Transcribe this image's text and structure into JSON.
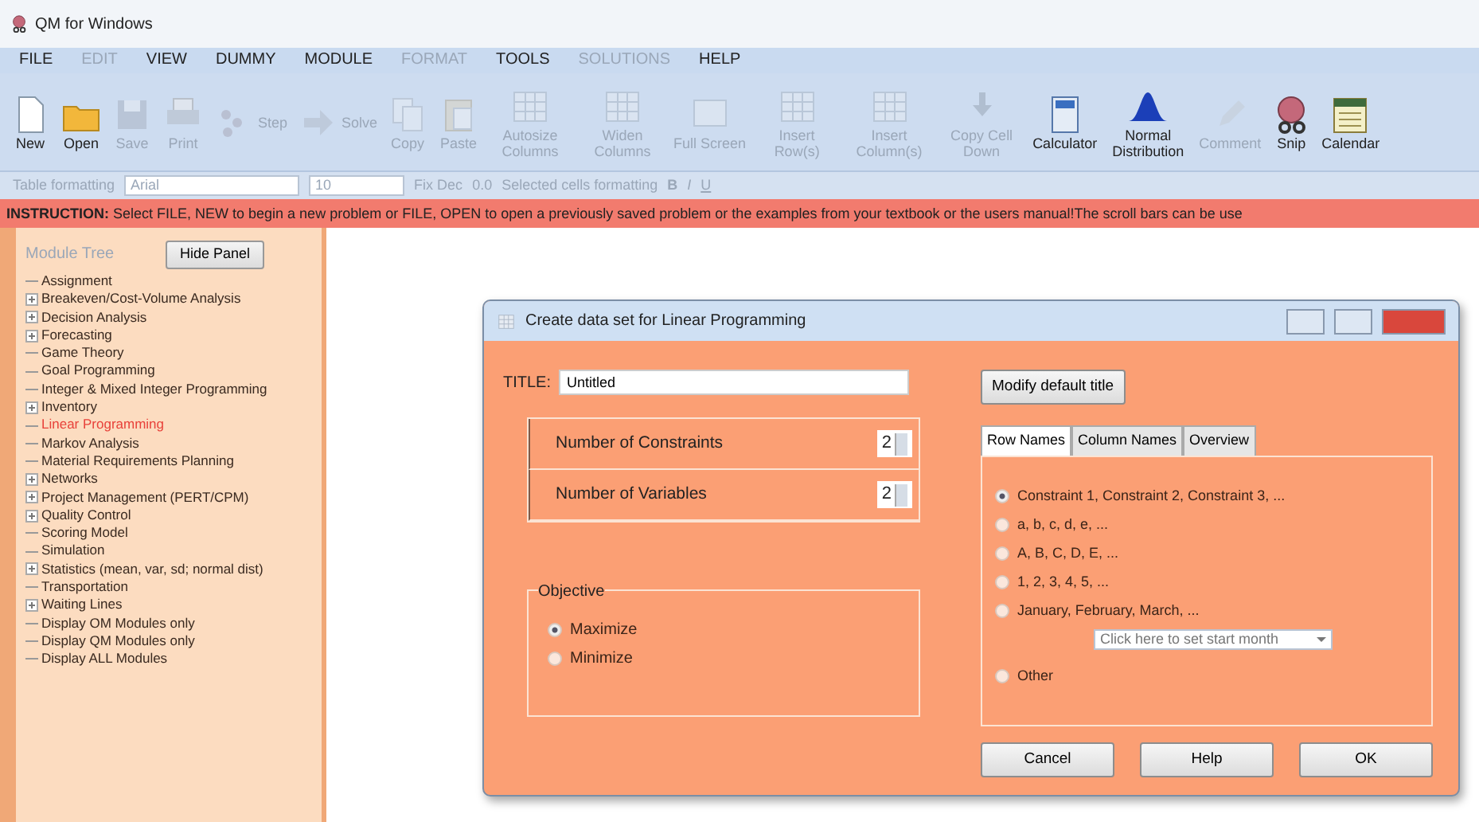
{
  "window": {
    "title": "QM for Windows"
  },
  "menu": [
    {
      "label": "FILE",
      "disabled": false
    },
    {
      "label": "EDIT",
      "disabled": true
    },
    {
      "label": "VIEW",
      "disabled": false
    },
    {
      "label": "DUMMY",
      "disabled": false
    },
    {
      "label": "MODULE",
      "disabled": false
    },
    {
      "label": "FORMAT",
      "disabled": true
    },
    {
      "label": "TOOLS",
      "disabled": false
    },
    {
      "label": "SOLUTIONS",
      "disabled": true
    },
    {
      "label": "HELP",
      "disabled": false
    }
  ],
  "toolbar": [
    {
      "label": "New",
      "kind": "document",
      "disabled": false
    },
    {
      "label": "Open",
      "kind": "folder",
      "disabled": false
    },
    {
      "label": "Save",
      "kind": "disk",
      "disabled": true
    },
    {
      "label": "Print",
      "kind": "printer",
      "disabled": true
    },
    {
      "label": "Step",
      "kind": "steps",
      "disabled": true
    },
    {
      "label": "Solve",
      "kind": "arrow",
      "disabled": true
    },
    {
      "label": "Copy",
      "kind": "copy",
      "disabled": true
    },
    {
      "label": "Paste",
      "kind": "paste",
      "disabled": true
    },
    {
      "label": "Autosize Columns",
      "kind": "grid",
      "disabled": true
    },
    {
      "label": "Widen Columns",
      "kind": "grid",
      "disabled": true
    },
    {
      "label": "Full Screen",
      "kind": "screen",
      "disabled": true
    },
    {
      "label": "Insert Row(s)",
      "kind": "grid",
      "disabled": true
    },
    {
      "label": "Insert Column(s)",
      "kind": "grid",
      "disabled": true
    },
    {
      "label": "Copy Cell Down",
      "kind": "down",
      "disabled": true
    },
    {
      "label": "Calculator",
      "kind": "calculator",
      "disabled": false
    },
    {
      "label": "Normal Distribution",
      "kind": "bell",
      "disabled": false
    },
    {
      "label": "Comment",
      "kind": "pencil",
      "disabled": true
    },
    {
      "label": "Snip",
      "kind": "snip",
      "disabled": false
    },
    {
      "label": "Calendar",
      "kind": "calendar",
      "disabled": false
    }
  ],
  "format_bar": {
    "label": "Table formatting",
    "font": "Arial",
    "size": "10",
    "fix_dec": "Fix Dec",
    "decimals": "0.0",
    "selected_label": "Selected cells formatting",
    "styles": [
      "B",
      "I",
      "U"
    ]
  },
  "instruction": {
    "label": "INSTRUCTION:",
    "text": "Select FILE, NEW to begin a new problem or FILE, OPEN to open a previously saved problem or the examples from your textbook or the users manual!The scroll bars can be use"
  },
  "module_tree": {
    "title": "Module Tree",
    "hide_button": "Hide Panel",
    "items": [
      {
        "label": "Assignment",
        "expandable": false,
        "selected": false
      },
      {
        "label": "Breakeven/Cost-Volume Analysis",
        "expandable": true,
        "selected": false
      },
      {
        "label": "Decision Analysis",
        "expandable": true,
        "selected": false
      },
      {
        "label": "Forecasting",
        "expandable": true,
        "selected": false
      },
      {
        "label": "Game Theory",
        "expandable": false,
        "selected": false
      },
      {
        "label": "Goal Programming",
        "expandable": false,
        "selected": false
      },
      {
        "label": "Integer & Mixed Integer Programming",
        "expandable": false,
        "selected": false
      },
      {
        "label": "Inventory",
        "expandable": true,
        "selected": false
      },
      {
        "label": "Linear Programming",
        "expandable": false,
        "selected": true
      },
      {
        "label": "Markov Analysis",
        "expandable": false,
        "selected": false
      },
      {
        "label": "Material Requirements Planning",
        "expandable": false,
        "selected": false
      },
      {
        "label": "Networks",
        "expandable": true,
        "selected": false
      },
      {
        "label": "Project Management (PERT/CPM)",
        "expandable": true,
        "selected": false
      },
      {
        "label": "Quality Control",
        "expandable": true,
        "selected": false
      },
      {
        "label": "Scoring Model",
        "expandable": false,
        "selected": false
      },
      {
        "label": "Simulation",
        "expandable": false,
        "selected": false
      },
      {
        "label": "Statistics (mean, var, sd; normal dist)",
        "expandable": true,
        "selected": false
      },
      {
        "label": "Transportation",
        "expandable": false,
        "selected": false
      },
      {
        "label": "Waiting Lines",
        "expandable": true,
        "selected": false
      },
      {
        "label": "Display OM Modules only",
        "expandable": false,
        "selected": false
      },
      {
        "label": "Display QM Modules only",
        "expandable": false,
        "selected": false
      },
      {
        "label": "Display ALL Modules",
        "expandable": false,
        "selected": false
      }
    ]
  },
  "dialog": {
    "title": "Create data set for Linear Programming",
    "title_field": {
      "label": "TITLE:",
      "value": "Untitled"
    },
    "spinners": [
      {
        "label": "Number of Constraints",
        "value": "2"
      },
      {
        "label": "Number of Variables",
        "value": "2"
      }
    ],
    "objective": {
      "title": "Objective",
      "options": [
        {
          "label": "Maximize",
          "selected": true
        },
        {
          "label": "Minimize",
          "selected": false
        }
      ]
    },
    "modify_button": "Modify default title",
    "tabs": [
      {
        "label": "Row Names",
        "selected": true
      },
      {
        "label": "Column Names",
        "selected": false
      },
      {
        "label": "Overview",
        "selected": false
      }
    ],
    "row_name_options": [
      {
        "label": "Constraint 1, Constraint 2, Constraint 3, ...",
        "selected": true
      },
      {
        "label": "a, b, c, d, e, ...",
        "selected": false
      },
      {
        "label": "A, B, C, D, E, ...",
        "selected": false
      },
      {
        "label": "1, 2, 3, 4, 5, ...",
        "selected": false
      },
      {
        "label": "January, February, March, ...",
        "selected": false,
        "dropdown": "Click here to set start month"
      },
      {
        "label": "Other",
        "selected": false
      }
    ],
    "buttons": [
      "Cancel",
      "Help",
      "OK"
    ]
  }
}
